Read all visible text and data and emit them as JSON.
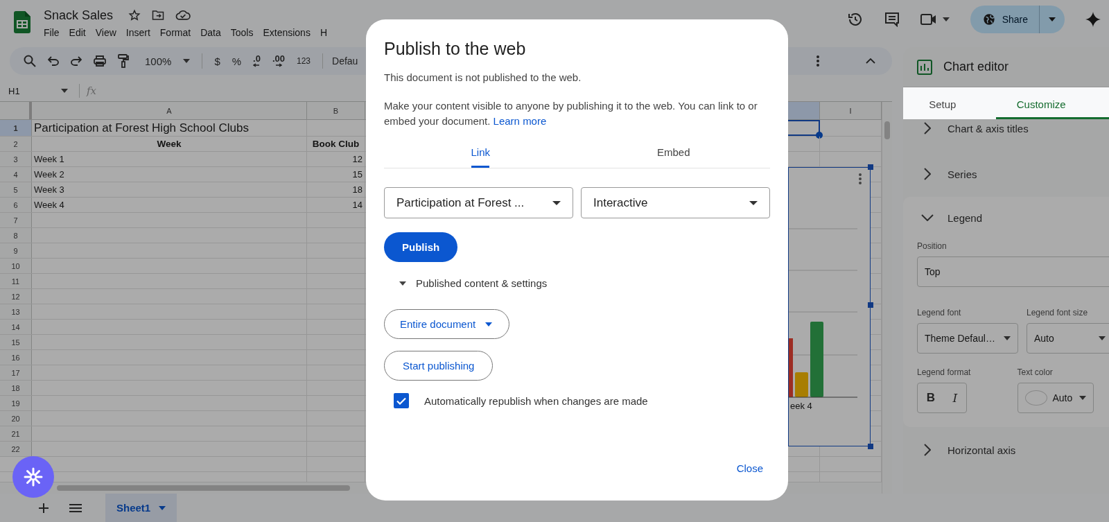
{
  "app": {
    "title": "Snack Sales",
    "menu": [
      "File",
      "Edit",
      "View",
      "Insert",
      "Format",
      "Data",
      "Tools",
      "Extensions",
      "H"
    ]
  },
  "header_actions": {
    "share": "Share"
  },
  "toolbar": {
    "zoom": "100%",
    "currency": "$",
    "percent": "%",
    "decrease_decimal": ".0",
    "increase_decimal": ".00",
    "number_format": "123",
    "font": "Defau"
  },
  "formula_bar": {
    "cell_ref": "H1",
    "fx": "fx"
  },
  "grid": {
    "columns": [
      {
        "header": "A",
        "selected": false
      },
      {
        "header": "B",
        "selected": false
      },
      {
        "selected": true
      },
      {
        "header": "I",
        "selected": false
      }
    ],
    "rows": [
      {
        "number": "1",
        "selected": true,
        "cells": [
          {
            "kind": "title",
            "text": "Participation at Forest High School Clubs"
          }
        ]
      },
      {
        "number": "2",
        "selected": false,
        "cells": [
          {
            "kind": "header",
            "text": "Week"
          },
          {
            "kind": "header",
            "text": "Book Club"
          }
        ]
      },
      {
        "number": "3",
        "selected": false,
        "cells": [
          {
            "kind": "text",
            "text": "Week 1"
          },
          {
            "kind": "number",
            "text": "12"
          }
        ]
      },
      {
        "number": "4",
        "selected": false,
        "cells": [
          {
            "kind": "text",
            "text": "Week 2"
          },
          {
            "kind": "number",
            "text": "15"
          }
        ]
      },
      {
        "number": "5",
        "selected": false,
        "cells": [
          {
            "kind": "text",
            "text": "Week 3"
          },
          {
            "kind": "number",
            "text": "18"
          }
        ]
      },
      {
        "number": "6",
        "selected": false,
        "cells": [
          {
            "kind": "text",
            "text": "Week 4"
          },
          {
            "kind": "number",
            "text": "14"
          }
        ]
      },
      {
        "number": "7",
        "selected": false
      },
      {
        "number": "8",
        "selected": false
      },
      {
        "number": "9",
        "selected": false
      },
      {
        "number": "10",
        "selected": false
      },
      {
        "number": "11",
        "selected": false
      },
      {
        "number": "12",
        "selected": false
      },
      {
        "number": "13",
        "selected": false
      },
      {
        "number": "14",
        "selected": false
      },
      {
        "number": "15",
        "selected": false
      },
      {
        "number": "16",
        "selected": false
      },
      {
        "number": "17",
        "selected": false
      },
      {
        "number": "18",
        "selected": false
      },
      {
        "number": "19",
        "selected": false
      },
      {
        "number": "20",
        "selected": false
      },
      {
        "number": "21",
        "selected": false
      },
      {
        "number": "22",
        "selected": false
      },
      {},
      {}
    ]
  },
  "chart": {
    "axis_label": "eek 4"
  },
  "chart_editor": {
    "title": "Chart editor",
    "tabs": [
      {
        "label": "Setup",
        "selected": false
      },
      {
        "label": "Customize",
        "selected": true
      }
    ],
    "sections": [
      {
        "title": "Chart & axis titles",
        "expanded": false
      },
      {
        "title": "Series",
        "expanded": false
      },
      {
        "title": "Legend",
        "expanded": true,
        "position": {
          "label": "Position",
          "value": "Top"
        },
        "font": {
          "label": "Legend font",
          "value": "Theme Defaul…"
        },
        "font_size": {
          "label": "Legend font size",
          "value": "Auto"
        },
        "format": {
          "label": "Legend format",
          "bold": "B",
          "italic": "I"
        },
        "text_color": {
          "label": "Text color",
          "value": "Auto"
        }
      },
      {
        "title": "Horizontal axis",
        "expanded": false
      }
    ]
  },
  "sheet_tabs": [
    {
      "label": "Sheet1",
      "selected": true
    }
  ],
  "dialog": {
    "title": "Publish to the web",
    "status": "This document is not published to the web.",
    "description": "Make your content visible to anyone by publishing it to the web. You can link to or embed your document.",
    "learn_more": "Learn more",
    "tabs": [
      {
        "label": "Link",
        "selected": true
      },
      {
        "label": "Embed",
        "selected": false
      }
    ],
    "source_select": "Participation at Forest ...",
    "mode_select": "Interactive",
    "publish": "Publish",
    "settings": {
      "label": "Published content & settings",
      "expanded": true,
      "scope": "Entire document",
      "start": "Start publishing",
      "auto_republish": {
        "label": "Automatically republish when changes are made",
        "checked": true
      }
    },
    "close": "Close"
  }
}
